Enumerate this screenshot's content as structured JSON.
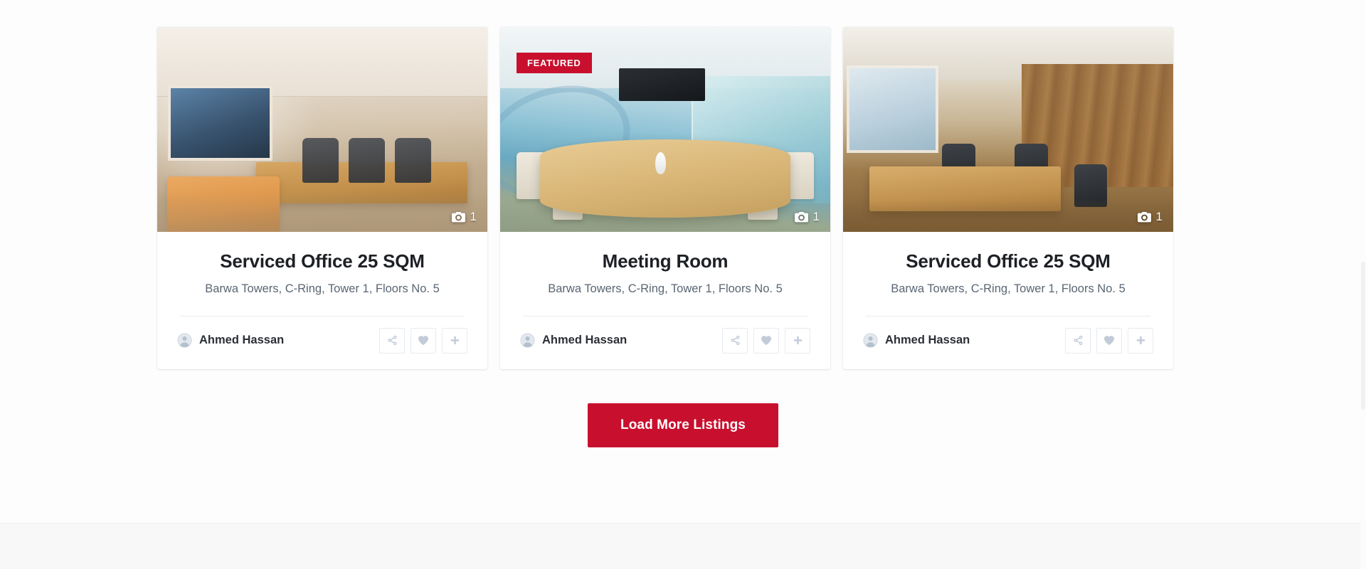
{
  "theme": {
    "accent": "#c8102e",
    "page_bg": "#fdfdfd",
    "card_bg": "#ffffff",
    "title_color": "#1d2025",
    "address_color": "#5a6673",
    "agent_color": "#2b2f36",
    "icon_color": "#c2cbd8",
    "footer_band_bg": "#f8f8f9"
  },
  "listings": [
    {
      "title": "Serviced Office 25 SQM",
      "address": "Barwa Towers, C-Ring, Tower 1, Floors No. 5",
      "agent": "Ahmed Hassan",
      "photo_count": "1",
      "featured": false,
      "featured_label": "",
      "scene": "office",
      "avatar_icon": "user-avatar-icon",
      "camera_icon": "camera-icon",
      "actions": [
        {
          "name": "share-button",
          "icon": "share-icon"
        },
        {
          "name": "favorite-button",
          "icon": "heart-icon"
        },
        {
          "name": "compare-button",
          "icon": "plus-icon"
        }
      ]
    },
    {
      "title": "Meeting Room",
      "address": "Barwa Towers, C-Ring, Tower 1, Floors No. 5",
      "agent": "Ahmed Hassan",
      "photo_count": "1",
      "featured": true,
      "featured_label": "FEATURED",
      "scene": "meeting",
      "avatar_icon": "user-avatar-icon",
      "camera_icon": "camera-icon",
      "actions": [
        {
          "name": "share-button",
          "icon": "share-icon"
        },
        {
          "name": "favorite-button",
          "icon": "heart-icon"
        },
        {
          "name": "compare-button",
          "icon": "plus-icon"
        }
      ]
    },
    {
      "title": "Serviced Office 25 SQM",
      "address": "Barwa Towers, C-Ring, Tower 1, Floors No. 5",
      "agent": "Ahmed Hassan",
      "photo_count": "1",
      "featured": false,
      "featured_label": "",
      "scene": "wood",
      "avatar_icon": "user-avatar-icon",
      "camera_icon": "camera-icon",
      "actions": [
        {
          "name": "share-button",
          "icon": "share-icon"
        },
        {
          "name": "favorite-button",
          "icon": "heart-icon"
        },
        {
          "name": "compare-button",
          "icon": "plus-icon"
        }
      ]
    }
  ],
  "load_more": {
    "label": "Load More Listings"
  }
}
